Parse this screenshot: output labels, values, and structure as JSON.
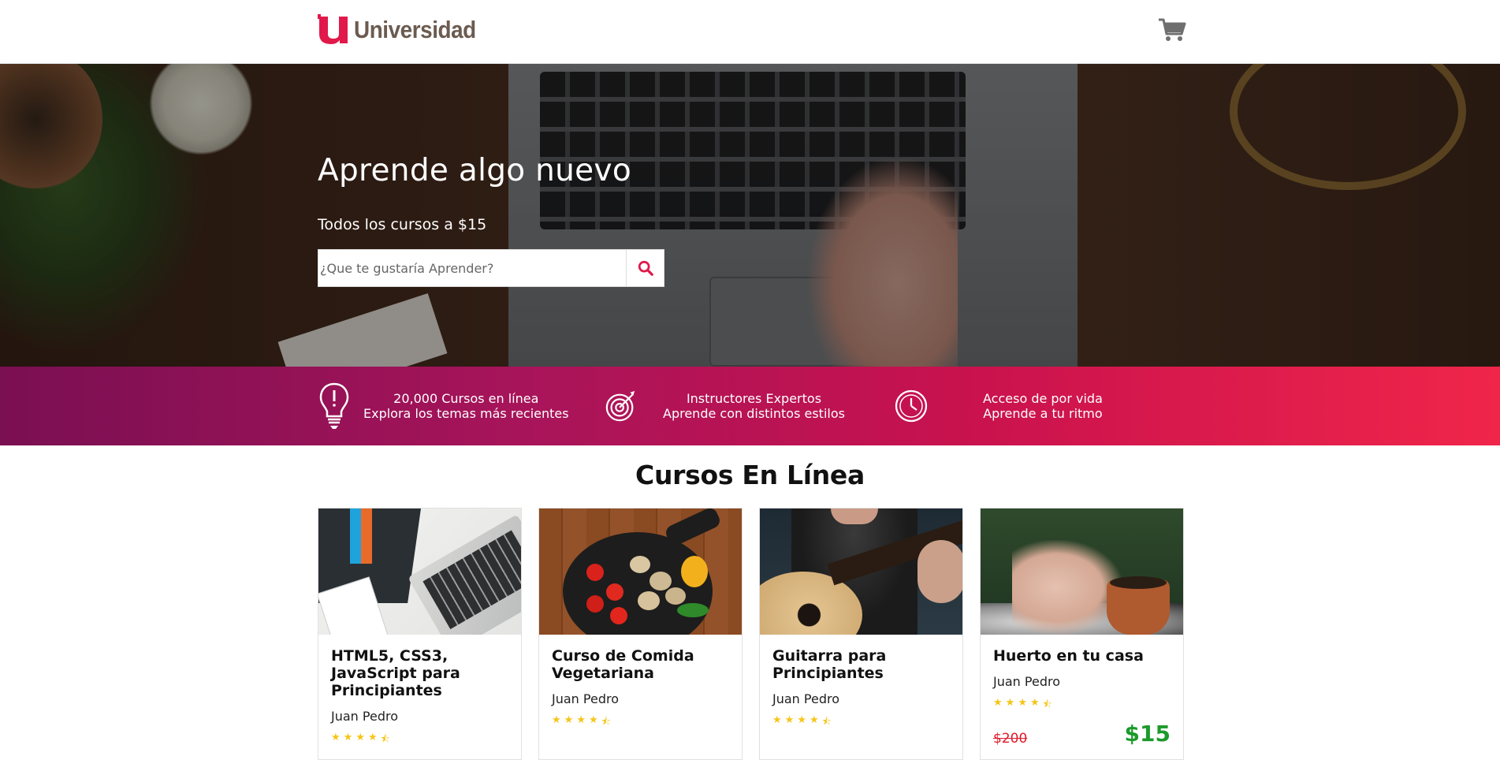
{
  "brand": {
    "logo_letter": "u",
    "name": "Universidad",
    "logo_color": "#e0194a"
  },
  "header": {
    "cart_icon": "shopping-cart-icon"
  },
  "hero": {
    "title": "Aprende algo nuevo",
    "subtitle": "Todos los cursos a $15",
    "search": {
      "placeholder": "¿Que te gustaría Aprender?",
      "value": "",
      "button_icon": "search-icon"
    }
  },
  "features": [
    {
      "icon": "lightbulb-icon",
      "line1": "20,000 Cursos en línea",
      "line2": "Explora los temas más recientes"
    },
    {
      "icon": "target-icon",
      "line1": "Instructores Expertos",
      "line2": "Aprende con distintos estilos"
    },
    {
      "icon": "clock-icon",
      "line1": "Acceso de por vida",
      "line2": "Aprende a tu ritmo"
    }
  ],
  "courses_section": {
    "title": "Cursos En Línea"
  },
  "courses": [
    {
      "title": "HTML5, CSS3, JavaScript para Principiantes",
      "author": "Juan Pedro",
      "rating": 4.5,
      "old_price": "",
      "new_price": ""
    },
    {
      "title": "Curso de Comida Vegetariana",
      "author": "Juan Pedro",
      "rating": 4.5,
      "old_price": "",
      "new_price": ""
    },
    {
      "title": "Guitarra para Principiantes",
      "author": "Juan Pedro",
      "rating": 4.5,
      "old_price": "",
      "new_price": ""
    },
    {
      "title": "Huerto en tu casa",
      "author": "Juan Pedro",
      "rating": 4.5,
      "old_price": "$200",
      "new_price": "$15"
    }
  ],
  "colors": {
    "accent": "#e0194a",
    "gradient_start": "#7a0f52",
    "gradient_end": "#f0254a",
    "star": "#f5c518",
    "old_price": "#e0192a",
    "new_price": "#1c9a2b"
  }
}
